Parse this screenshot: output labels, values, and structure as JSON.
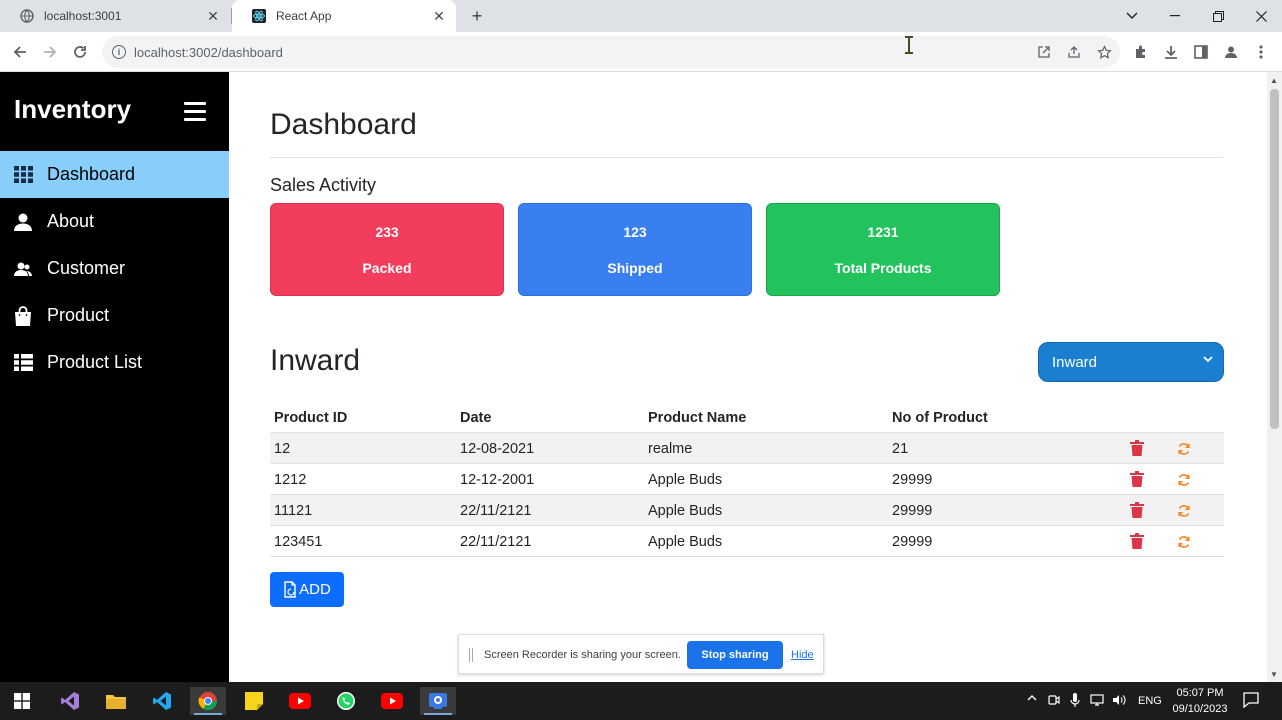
{
  "browser": {
    "tabs": [
      {
        "title": "localhost:3001",
        "active": false
      },
      {
        "title": "React App",
        "active": true
      }
    ],
    "url": "localhost:3002/dashboard"
  },
  "sidebar": {
    "brand": "Inventory",
    "items": [
      {
        "label": "Dashboard",
        "icon": "grid-icon",
        "active": true
      },
      {
        "label": "About",
        "icon": "person-icon",
        "active": false
      },
      {
        "label": "Customer",
        "icon": "people-icon",
        "active": false
      },
      {
        "label": "Product",
        "icon": "bag-icon",
        "active": false
      },
      {
        "label": "Product List",
        "icon": "list-icon",
        "active": false
      }
    ]
  },
  "main": {
    "title": "Dashboard",
    "sales_label": "Sales Activity",
    "cards": [
      {
        "value": "233",
        "label": "Packed",
        "color": "#f33d5d"
      },
      {
        "value": "123",
        "label": "Shipped",
        "color": "#3a7fef"
      },
      {
        "value": "1231",
        "label": "Total Products",
        "color": "#22c25c"
      }
    ],
    "section_title": "Inward",
    "select_value": "Inward",
    "table": {
      "headers": [
        "Product ID",
        "Date",
        "Product Name",
        "No of Product"
      ],
      "rows": [
        [
          "12",
          "12-08-2021",
          "realme",
          "21"
        ],
        [
          "1212",
          "12-12-2001",
          "Apple Buds",
          "29999"
        ],
        [
          "11121",
          "22/11/2121",
          "Apple Buds",
          "29999"
        ],
        [
          "123451",
          "22/11/2121",
          "Apple Buds",
          "29999"
        ]
      ]
    },
    "add_label": "ADD"
  },
  "share_banner": {
    "text": "Screen Recorder is sharing your screen.",
    "stop_label": "Stop sharing",
    "hide_label": "Hide"
  },
  "taskbar": {
    "language": "ENG",
    "time": "05:07 PM",
    "date": "09/10/2023"
  }
}
